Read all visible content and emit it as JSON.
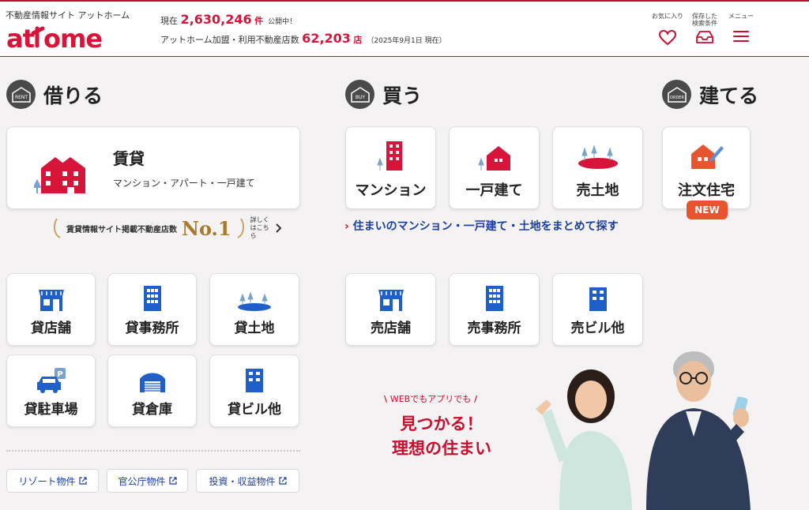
{
  "header": {
    "tagline": "不動産情報サイト アットホーム",
    "logo": "at home",
    "stat1": {
      "prefix": "現在",
      "count": "2,630,246",
      "unit": "件",
      "suffix": "公開中！"
    },
    "stat2": {
      "prefix": "アットホーム加盟・利用不動産店数",
      "count": "62,203",
      "unit": "店",
      "note": "（2025年9月1日 現在）"
    },
    "favorites_label": "お気に入り",
    "saved_label": "保存した検索条件",
    "menu_label": "メニュー"
  },
  "rent": {
    "badge": "RENT",
    "title": "借りる",
    "main_card": {
      "title": "賃貸",
      "sub": "マンション・アパート・一戸建て"
    },
    "no1": {
      "text": "賃貸情報サイト掲載不動産店数",
      "rank": "No.1",
      "more": "詳しくはこちら"
    },
    "cards": [
      "貸店舗",
      "貸事務所",
      "貸土地",
      "貸駐車場",
      "貸倉庫",
      "貸ビル他"
    ],
    "links": [
      "リゾート物件",
      "官公庁物件",
      "投資・収益物件"
    ]
  },
  "buy": {
    "badge": "BUY",
    "title": "買う",
    "cards_top": [
      "マンション",
      "一戸建て",
      "売土地"
    ],
    "link": "住まいのマンション・一戸建て・土地をまとめて探す",
    "cards_bottom": [
      "売店舗",
      "売事務所",
      "売ビル他"
    ]
  },
  "order": {
    "badge": "ORDER",
    "title": "建てる",
    "card": "注文住宅",
    "new_badge": "NEW"
  },
  "promo": {
    "small": "WEBでもアプリでも",
    "line1": "見つかる！",
    "line2": "理想の住まい"
  },
  "colors": {
    "brand": "#d7153a",
    "link": "#1a3fa3",
    "new": "#e8542d",
    "icon_blue": "#1e5fc9"
  }
}
